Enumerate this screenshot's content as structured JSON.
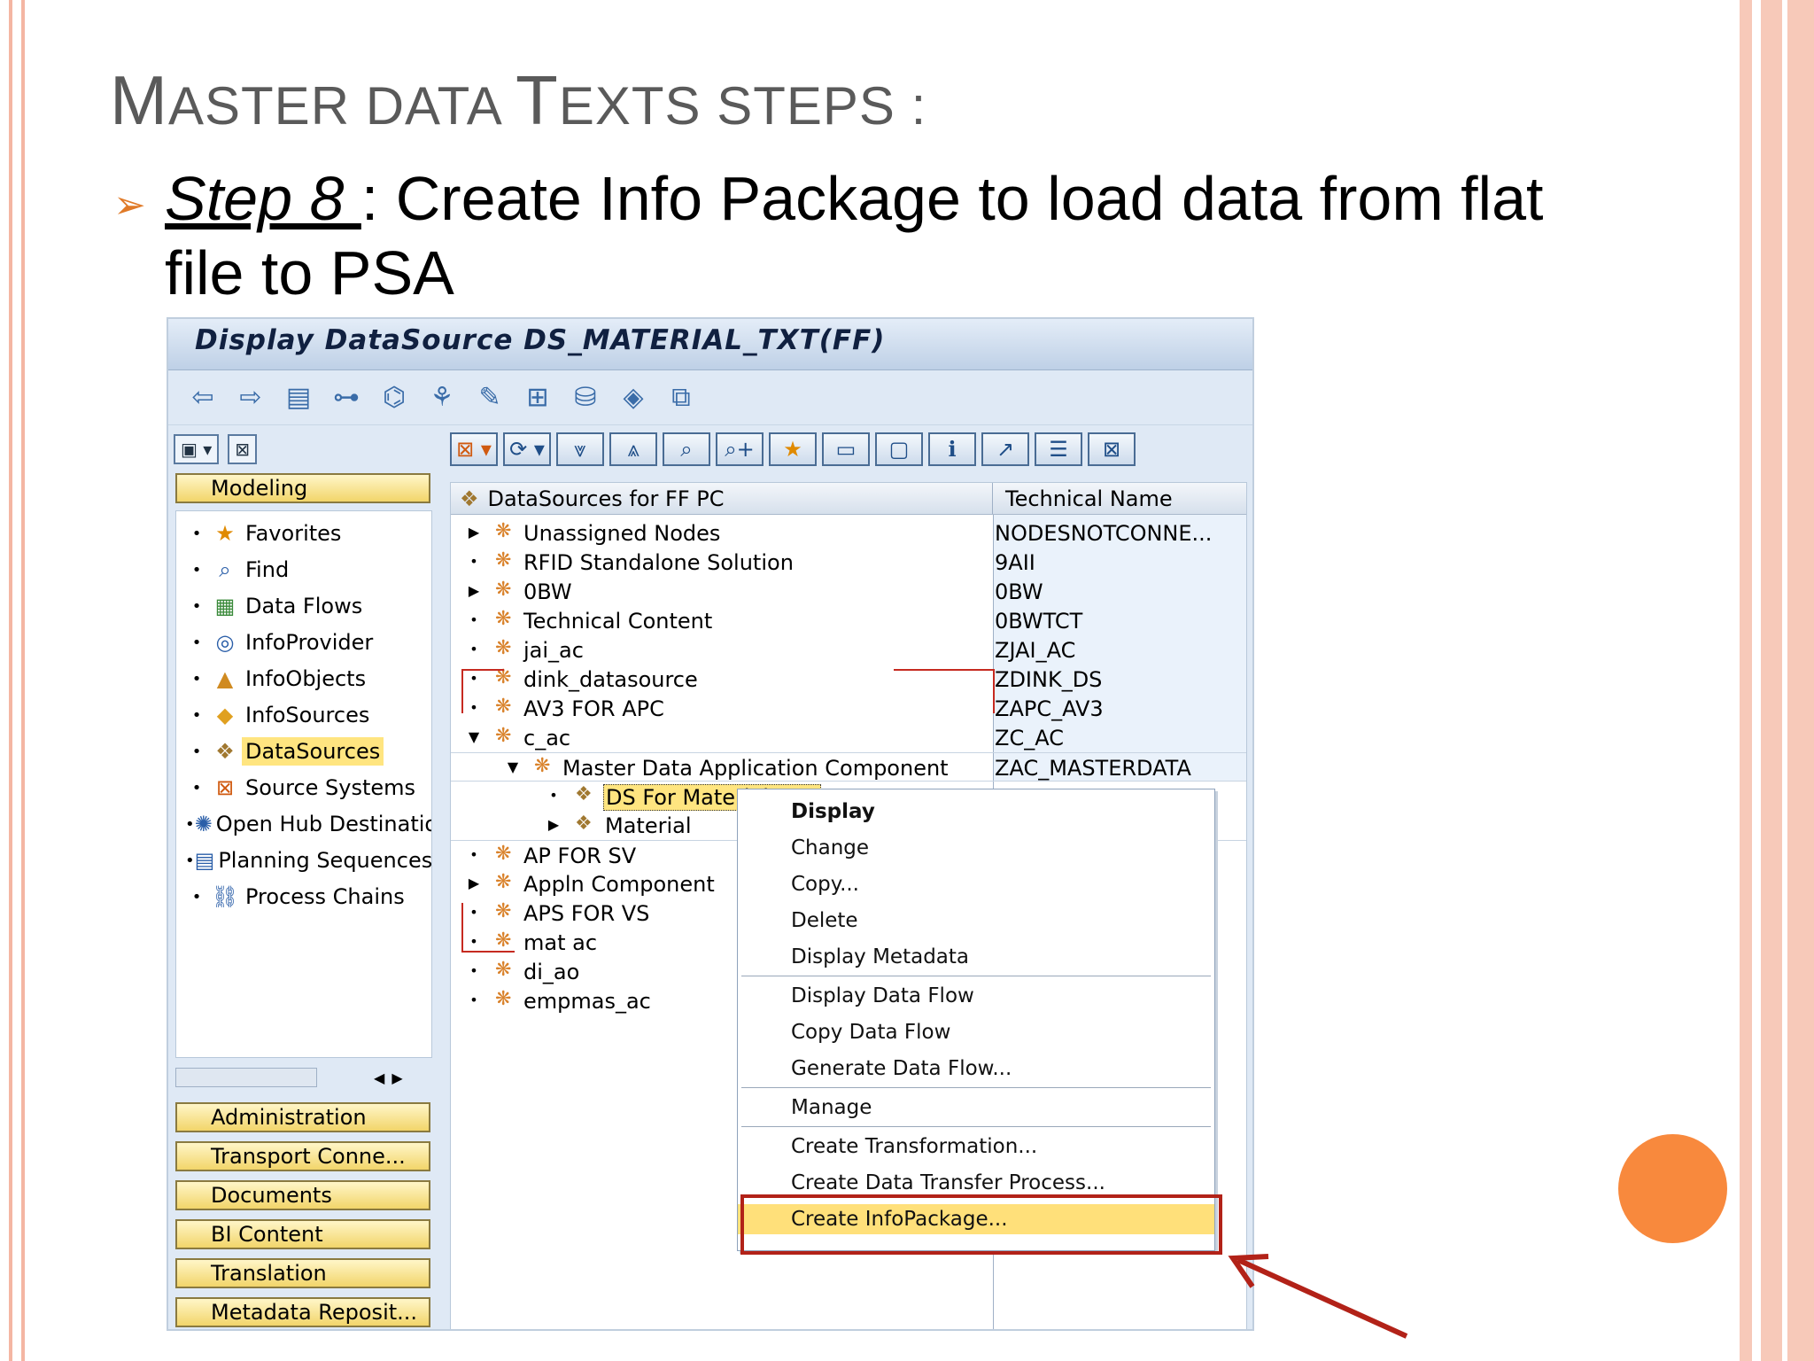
{
  "slide": {
    "title_first": "M",
    "title_rest1": "ASTER DATA ",
    "title_T": "T",
    "title_rest2": "EXTS STEPS :",
    "bullet_glyph": "➢",
    "step_label": "Step 8 ",
    "step_text": ": Create Info Package to load data from flat file to PSA"
  },
  "window": {
    "title": "Display DataSource DS_MATERIAL_TXT(FF)",
    "toolbar_icons": [
      "back-icon",
      "forward-icon",
      "list-icon",
      "hierarchy-icon",
      "glasses-icon",
      "tree-icon",
      "wand-icon",
      "structure-icon",
      "database-icon",
      "cube-icon",
      "copy-icon"
    ]
  },
  "left": {
    "modeling": "Modeling",
    "nav_items": [
      {
        "label": "Favorites",
        "icon": "★"
      },
      {
        "label": "Find",
        "icon": "⌕"
      },
      {
        "label": "Data Flows",
        "icon": "▦"
      },
      {
        "label": "InfoProvider",
        "icon": "◎"
      },
      {
        "label": "InfoObjects",
        "icon": "▲"
      },
      {
        "label": "InfoSources",
        "icon": "◆"
      },
      {
        "label": "DataSources",
        "icon": "❖"
      },
      {
        "label": "Source Systems",
        "icon": "⊠"
      },
      {
        "label": "Open Hub Destinations",
        "icon": "✺"
      },
      {
        "label": "Planning Sequences",
        "icon": "▤"
      },
      {
        "label": "Process Chains",
        "icon": "⛓"
      }
    ],
    "buttons": [
      "Administration",
      "Transport Conne...",
      "Documents",
      "BI Content",
      "Translation",
      "Metadata Reposit..."
    ]
  },
  "tree": {
    "header_col1": "DataSources for FF PC",
    "header_col2": "Technical Name",
    "rows": [
      {
        "label": "Unassigned Nodes",
        "tech": "NODESNOTCONNE..."
      },
      {
        "label": "RFID Standalone Solution",
        "tech": "9AII"
      },
      {
        "label": "0BW",
        "tech": "0BW"
      },
      {
        "label": "Technical Content",
        "tech": "0BWTCT"
      },
      {
        "label": "jai_ac",
        "tech": "ZJAI_AC"
      },
      {
        "label": "dink_datasource",
        "tech": "ZDINK_DS"
      },
      {
        "label": "AV3 FOR APC",
        "tech": "ZAPC_AV3"
      },
      {
        "label": "c_ac",
        "tech": "ZC_AC"
      },
      {
        "label": "Master Data Application Component",
        "tech": "ZAC_MASTERDATA"
      },
      {
        "label": "DS For Material",
        "tech": ""
      },
      {
        "label": "Material",
        "tech": ""
      },
      {
        "label": "AP FOR SV",
        "tech": ""
      },
      {
        "label": "Appln Component",
        "tech": ""
      },
      {
        "label": "APS FOR VS",
        "tech": ""
      },
      {
        "label": "mat ac",
        "tech": ""
      },
      {
        "label": "di_ao",
        "tech": ""
      },
      {
        "label": "empmas_ac",
        "tech": ""
      }
    ]
  },
  "context_menu": {
    "items": [
      "Display",
      "Change",
      "Copy...",
      "Delete",
      "Display Metadata",
      "Display Data Flow",
      "Copy Data Flow",
      "Generate Data Flow...",
      "Manage",
      "Create Transformation...",
      "Create Data Transfer Process...",
      "Create InfoPackage..."
    ],
    "highlighted": "Create InfoPackage..."
  }
}
